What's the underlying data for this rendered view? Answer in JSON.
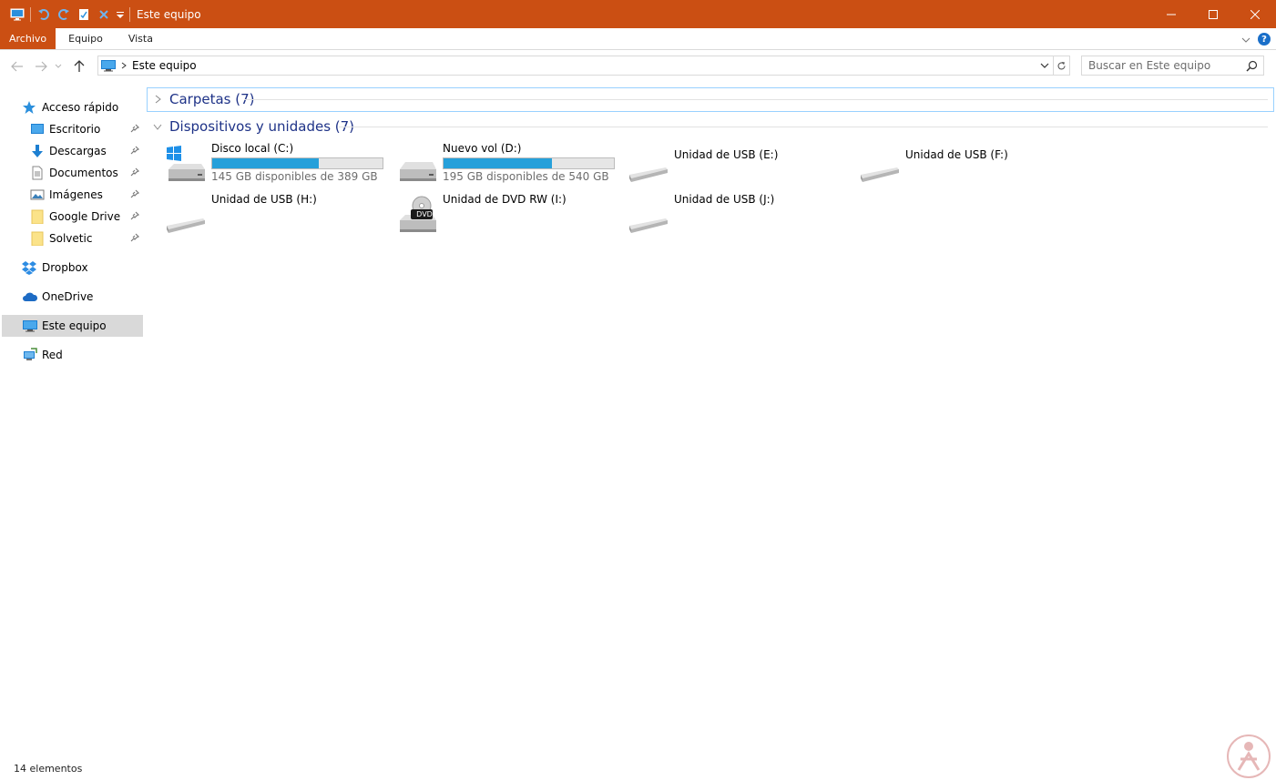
{
  "window": {
    "title": "Este equipo",
    "accent": "#cb4f13"
  },
  "ribbon": {
    "tabs": [
      "Archivo",
      "Equipo",
      "Vista"
    ]
  },
  "address": {
    "path": "Este equipo"
  },
  "search": {
    "placeholder": "Buscar en Este equipo"
  },
  "sidebar": {
    "quick_access": "Acceso rápido",
    "pinned": [
      {
        "label": "Escritorio",
        "icon": "desktop-icon"
      },
      {
        "label": "Descargas",
        "icon": "download-icon"
      },
      {
        "label": "Documentos",
        "icon": "document-icon"
      },
      {
        "label": "Imágenes",
        "icon": "pictures-icon"
      },
      {
        "label": "Google Drive",
        "icon": "folder-icon"
      },
      {
        "label": "Solvetic",
        "icon": "folder-icon"
      }
    ],
    "dropbox": "Dropbox",
    "onedrive": "OneDrive",
    "this_pc": "Este equipo",
    "network": "Red"
  },
  "groups": {
    "folders": "Carpetas (7)",
    "devices": "Dispositivos y unidades (7)"
  },
  "drives": [
    {
      "name": "Disco local (C:)",
      "free": "145 GB disponibles de 389 GB",
      "used_fraction": 0.627,
      "type": "system"
    },
    {
      "name": "Nuevo vol (D:)",
      "free": "195 GB disponibles de 540 GB",
      "used_fraction": 0.639,
      "type": "hdd"
    },
    {
      "name": "Unidad de USB (E:)",
      "type": "usb"
    },
    {
      "name": "Unidad de USB (F:)",
      "type": "usb"
    },
    {
      "name": "Unidad de USB (H:)",
      "type": "usb"
    },
    {
      "name": "Unidad de DVD RW (I:)",
      "type": "dvd",
      "badge": "DVD"
    },
    {
      "name": "Unidad de USB (J:)",
      "type": "usb"
    }
  ],
  "status": {
    "count": "14 elementos"
  }
}
